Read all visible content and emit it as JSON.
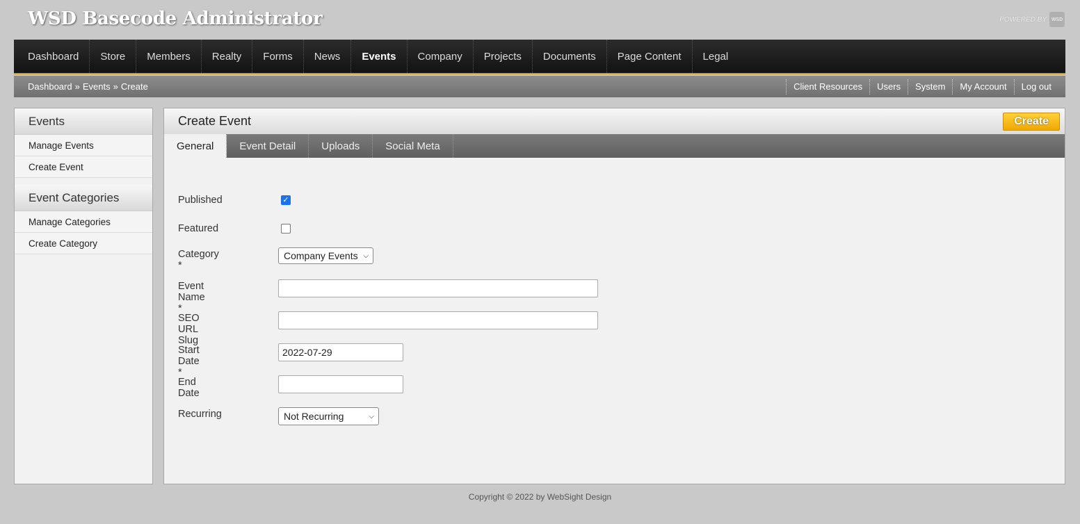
{
  "header": {
    "title": "WSD Basecode Administrator",
    "powered_by": "POWERED BY",
    "badge": "WSD"
  },
  "nav": {
    "items": [
      {
        "label": "Dashboard"
      },
      {
        "label": "Store"
      },
      {
        "label": "Members"
      },
      {
        "label": "Realty"
      },
      {
        "label": "Forms"
      },
      {
        "label": "News"
      },
      {
        "label": "Events"
      },
      {
        "label": "Company"
      },
      {
        "label": "Projects"
      },
      {
        "label": "Documents"
      },
      {
        "label": "Page Content"
      },
      {
        "label": "Legal"
      }
    ],
    "active": "Events"
  },
  "breadcrumb": {
    "a": "Dashboard",
    "sep": "»",
    "b": "Events",
    "c": "Create"
  },
  "utility": {
    "items": [
      {
        "label": "Client Resources"
      },
      {
        "label": "Users"
      },
      {
        "label": "System"
      },
      {
        "label": "My Account"
      },
      {
        "label": "Log out"
      }
    ]
  },
  "sidebar": {
    "section1": {
      "title": "Events",
      "items": [
        {
          "label": "Manage Events"
        },
        {
          "label": "Create Event"
        }
      ]
    },
    "section2": {
      "title": "Event Categories",
      "items": [
        {
          "label": "Manage Categories"
        },
        {
          "label": "Create Category"
        }
      ]
    }
  },
  "panel": {
    "title": "Create Event",
    "create_label": "Create",
    "tabs": [
      {
        "label": "General"
      },
      {
        "label": "Event Detail"
      },
      {
        "label": "Uploads"
      },
      {
        "label": "Social Meta"
      }
    ]
  },
  "form": {
    "published": {
      "label": "Published",
      "checked": true
    },
    "featured": {
      "label": "Featured",
      "checked": false
    },
    "category": {
      "label": "Category *",
      "value": "Company Events"
    },
    "event_name": {
      "label": "Event Name *",
      "value": ""
    },
    "seo_slug": {
      "label": "SEO URL Slug",
      "value": ""
    },
    "start_date": {
      "label": "Start Date *",
      "value": "2022-07-29"
    },
    "end_date": {
      "label": "End Date",
      "value": ""
    },
    "recurring": {
      "label": "Recurring",
      "value": "Not Recurring"
    }
  },
  "footer": {
    "text": "Copyright © 2022 by WebSight Design"
  },
  "colors": {
    "accent": "#f0a800",
    "nav_bg": "#1a1a1a",
    "check": "#1a73e8"
  }
}
